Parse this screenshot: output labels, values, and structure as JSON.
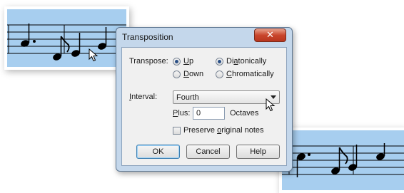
{
  "dialog": {
    "title": "Transposition",
    "close_glyph": "✕",
    "transpose": {
      "label": "Transpose:",
      "options": [
        {
          "label_pre": "",
          "label_key": "U",
          "label_post": "p",
          "selected": true
        },
        {
          "label_pre": "",
          "label_key": "D",
          "label_post": "own",
          "selected": false
        },
        {
          "label_pre": "Di",
          "label_key": "a",
          "label_post": "tonically",
          "selected": true
        },
        {
          "label_pre": "",
          "label_key": "C",
          "label_post": "hromatically",
          "selected": false
        }
      ]
    },
    "interval": {
      "label_key": "I",
      "label_post": "nterval:",
      "value": "Fourth"
    },
    "plus": {
      "label_key": "P",
      "label_post": "lus:",
      "value": "0",
      "unit": "Octaves"
    },
    "preserve": {
      "label_pre": "Preserve ",
      "label_key": "o",
      "label_post": "riginal notes",
      "checked": false
    },
    "buttons": {
      "ok": "OK",
      "cancel": "Cancel",
      "help": "Help"
    }
  },
  "colors": {
    "staff_panel": "#a7ceef",
    "dialog_frame": "#c4d7eb",
    "close_button": "#c9452c"
  },
  "icons": [
    "close-icon",
    "dropdown-arrow-icon",
    "mouse-cursor-icon"
  ]
}
